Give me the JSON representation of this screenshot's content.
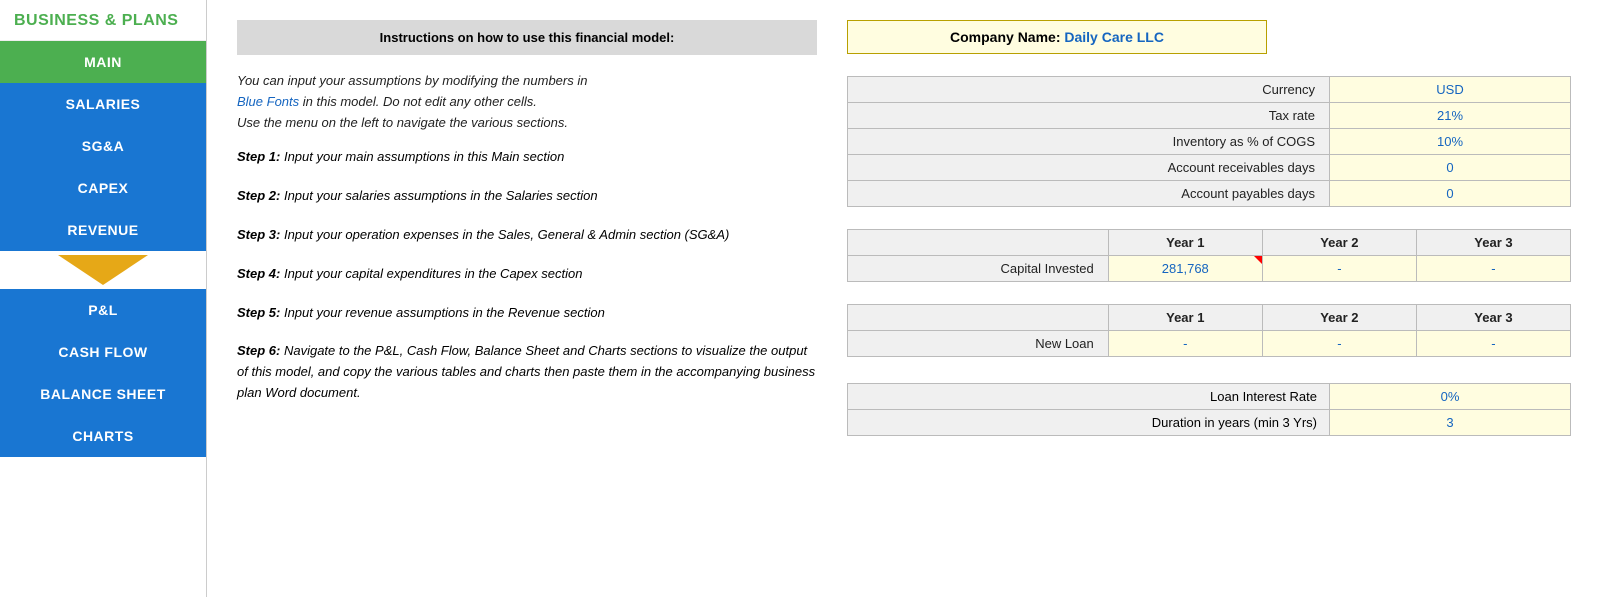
{
  "logo": {
    "text_before": "BUSINESS ",
    "ampersand": "& ",
    "text_after": "PLANS"
  },
  "sidebar": {
    "items": [
      {
        "label": "MAIN",
        "style": "green"
      },
      {
        "label": "SALARIES",
        "style": "blue"
      },
      {
        "label": "SG&A",
        "style": "blue"
      },
      {
        "label": "CAPEX",
        "style": "blue"
      },
      {
        "label": "REVENUE",
        "style": "blue"
      },
      {
        "label": "ARROW",
        "style": "arrow"
      },
      {
        "label": "P&L",
        "style": "blue"
      },
      {
        "label": "CASH FLOW",
        "style": "blue"
      },
      {
        "label": "BALANCE SHEET",
        "style": "blue"
      },
      {
        "label": "CHARTS",
        "style": "blue"
      }
    ]
  },
  "instructions": {
    "header": "Instructions on how to use this financial model:",
    "intro_line1": "You can input your assumptions by modifying the numbers in",
    "intro_blue": "Blue Fonts",
    "intro_line2": " in this model. Do not edit any other cells.",
    "intro_line3": "Use the menu on the left to navigate the various sections.",
    "steps": [
      {
        "label": "Step 1:",
        "text": "Input your main assumptions in this Main section"
      },
      {
        "label": "Step 2:",
        "text": "Input your salaries assumptions in the Salaries section"
      },
      {
        "label": "Step 3:",
        "text": "Input your operation expenses in the Sales, General & Admin section (SG&A)"
      },
      {
        "label": "Step 4:",
        "text": "Input your capital expenditures in the Capex section"
      },
      {
        "label": "Step 5:",
        "text": "Input your revenue assumptions in the Revenue section"
      },
      {
        "label": "Step 6:",
        "text": "Navigate to the P&L, Cash Flow, Balance Sheet and Charts sections to visualize the output of this model, and copy the various tables and charts then paste them in the accompanying business plan Word document."
      }
    ]
  },
  "company": {
    "label": "Company Name:",
    "value": "Daily Care LLC"
  },
  "settings_table": {
    "rows": [
      {
        "label": "Currency",
        "value": "USD"
      },
      {
        "label": "Tax rate",
        "value": "21%"
      },
      {
        "label": "Inventory as % of COGS",
        "value": "10%"
      },
      {
        "label": "Account receivables days",
        "value": "0"
      },
      {
        "label": "Account payables days",
        "value": "0"
      }
    ]
  },
  "capital_table": {
    "headers": [
      "",
      "Year 1",
      "Year 2",
      "Year 3"
    ],
    "rows": [
      {
        "label": "Capital Invested",
        "values": [
          "281,768",
          "-",
          "-"
        ],
        "has_corner": true
      }
    ]
  },
  "loan_table": {
    "headers": [
      "",
      "Year 1",
      "Year 2",
      "Year 3"
    ],
    "rows": [
      {
        "label": "New Loan",
        "values": [
          "-",
          "-",
          "-"
        ]
      }
    ]
  },
  "loan_details": {
    "rows": [
      {
        "label": "Loan Interest Rate",
        "value": "0%"
      },
      {
        "label": "Duration in years (min 3 Yrs)",
        "value": "3"
      }
    ]
  }
}
